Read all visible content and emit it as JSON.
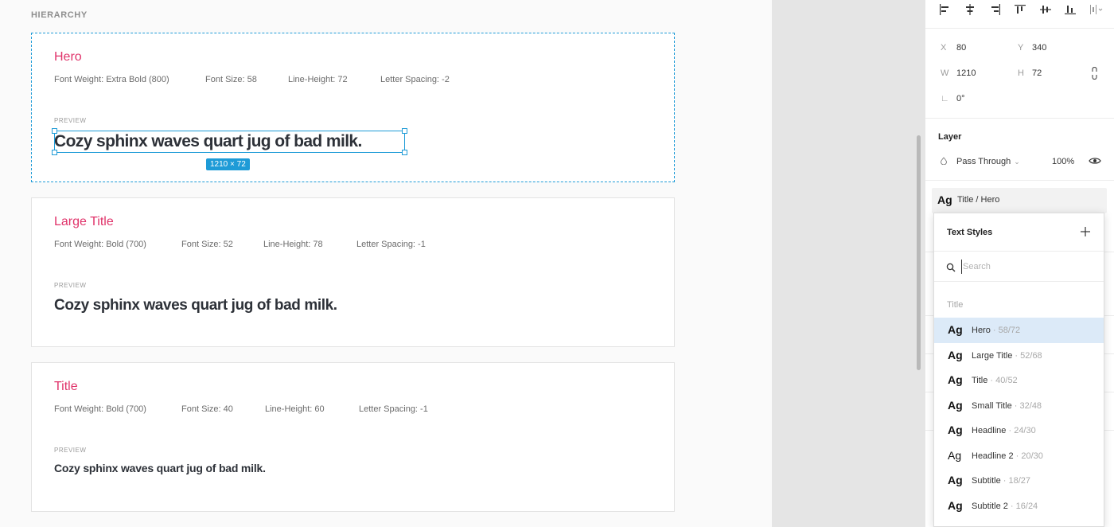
{
  "canvas": {
    "section_label": "HIERARCHY",
    "cards": [
      {
        "title": "Hero",
        "specs": [
          "Font Weight: Extra Bold (800)",
          "Font Size: 58",
          "Line-Height: 72",
          "Letter Spacing: -2"
        ],
        "preview_label": "PREVIEW",
        "preview_text": "Cozy sphinx waves quart jug of bad milk.",
        "selection_badge": "1210 × 72"
      },
      {
        "title": "Large Title",
        "specs": [
          "Font Weight: Bold (700)",
          "Font Size: 52",
          "Line-Height: 78",
          "Letter Spacing: -1"
        ],
        "preview_label": "PREVIEW",
        "preview_text": "Cozy sphinx waves quart jug of bad milk."
      },
      {
        "title": "Title",
        "specs": [
          "Font Weight: Bold (700)",
          "Font Size: 40",
          "Line-Height: 60",
          "Letter Spacing: -1"
        ],
        "preview_label": "PREVIEW",
        "preview_text": "Cozy sphinx waves quart jug of bad milk."
      }
    ]
  },
  "panel": {
    "align_icons": [
      "align-left-icon",
      "align-horizontal-center-icon",
      "align-right-icon",
      "align-top-icon",
      "align-vertical-center-icon",
      "align-bottom-icon",
      "distribute-icon"
    ],
    "props": {
      "x_label": "X",
      "x_value": "80",
      "y_label": "Y",
      "y_value": "340",
      "w_label": "W",
      "w_value": "1210",
      "h_label": "H",
      "h_value": "72",
      "rotation_label": "∟",
      "rotation_value": "0°"
    },
    "layer": {
      "title": "Layer",
      "blend_mode": "Pass Through",
      "opacity": "100%"
    },
    "text_style": {
      "ag": "Ag",
      "name": "Title / Hero"
    }
  },
  "dropdown": {
    "title": "Text Styles",
    "search_placeholder": "Search",
    "group_label": "Title",
    "items": [
      {
        "ag": "Ag",
        "name": "Hero",
        "spec": " · 58/72"
      },
      {
        "ag": "Ag",
        "name": "Large Title",
        "spec": " · 52/68"
      },
      {
        "ag": "Ag",
        "name": "Title",
        "spec": " · 40/52"
      },
      {
        "ag": "Ag",
        "name": "Small Title",
        "spec": " · 32/48"
      },
      {
        "ag": "Ag",
        "name": "Headline",
        "spec": " · 24/30"
      },
      {
        "ag": "Ag",
        "name": "Headline 2",
        "spec": " · 20/30"
      },
      {
        "ag": "Ag",
        "name": "Subtitle",
        "spec": " · 18/27"
      },
      {
        "ag": "Ag",
        "name": "Subtitle 2",
        "spec": " · 16/24"
      }
    ]
  },
  "colors": {
    "accent": "#e0336a",
    "selection": "#1e9bd7",
    "active_item": "#dceaf8"
  }
}
